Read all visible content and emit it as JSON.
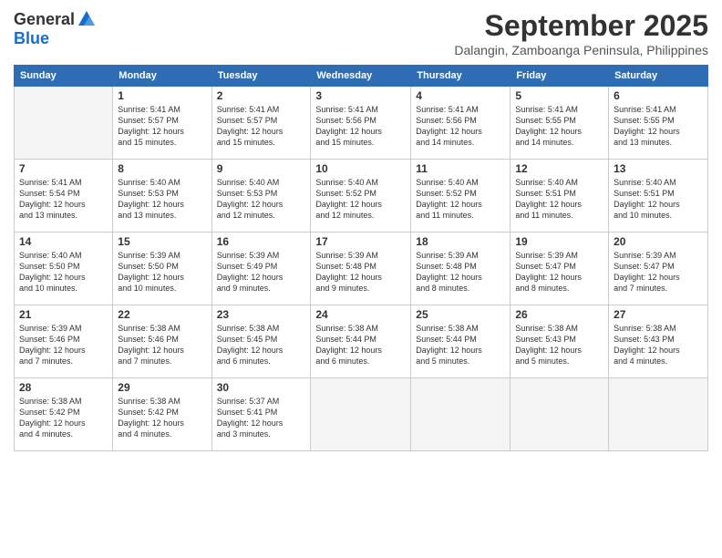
{
  "logo": {
    "general": "General",
    "blue": "Blue"
  },
  "title": "September 2025",
  "subtitle": "Dalangin, Zamboanga Peninsula, Philippines",
  "days": [
    "Sunday",
    "Monday",
    "Tuesday",
    "Wednesday",
    "Thursday",
    "Friday",
    "Saturday"
  ],
  "weeks": [
    [
      {
        "day": "",
        "info": ""
      },
      {
        "day": "1",
        "info": "Sunrise: 5:41 AM\nSunset: 5:57 PM\nDaylight: 12 hours\nand 15 minutes."
      },
      {
        "day": "2",
        "info": "Sunrise: 5:41 AM\nSunset: 5:57 PM\nDaylight: 12 hours\nand 15 minutes."
      },
      {
        "day": "3",
        "info": "Sunrise: 5:41 AM\nSunset: 5:56 PM\nDaylight: 12 hours\nand 15 minutes."
      },
      {
        "day": "4",
        "info": "Sunrise: 5:41 AM\nSunset: 5:56 PM\nDaylight: 12 hours\nand 14 minutes."
      },
      {
        "day": "5",
        "info": "Sunrise: 5:41 AM\nSunset: 5:55 PM\nDaylight: 12 hours\nand 14 minutes."
      },
      {
        "day": "6",
        "info": "Sunrise: 5:41 AM\nSunset: 5:55 PM\nDaylight: 12 hours\nand 13 minutes."
      }
    ],
    [
      {
        "day": "7",
        "info": "Sunrise: 5:41 AM\nSunset: 5:54 PM\nDaylight: 12 hours\nand 13 minutes."
      },
      {
        "day": "8",
        "info": "Sunrise: 5:40 AM\nSunset: 5:53 PM\nDaylight: 12 hours\nand 13 minutes."
      },
      {
        "day": "9",
        "info": "Sunrise: 5:40 AM\nSunset: 5:53 PM\nDaylight: 12 hours\nand 12 minutes."
      },
      {
        "day": "10",
        "info": "Sunrise: 5:40 AM\nSunset: 5:52 PM\nDaylight: 12 hours\nand 12 minutes."
      },
      {
        "day": "11",
        "info": "Sunrise: 5:40 AM\nSunset: 5:52 PM\nDaylight: 12 hours\nand 11 minutes."
      },
      {
        "day": "12",
        "info": "Sunrise: 5:40 AM\nSunset: 5:51 PM\nDaylight: 12 hours\nand 11 minutes."
      },
      {
        "day": "13",
        "info": "Sunrise: 5:40 AM\nSunset: 5:51 PM\nDaylight: 12 hours\nand 10 minutes."
      }
    ],
    [
      {
        "day": "14",
        "info": "Sunrise: 5:40 AM\nSunset: 5:50 PM\nDaylight: 12 hours\nand 10 minutes."
      },
      {
        "day": "15",
        "info": "Sunrise: 5:39 AM\nSunset: 5:50 PM\nDaylight: 12 hours\nand 10 minutes."
      },
      {
        "day": "16",
        "info": "Sunrise: 5:39 AM\nSunset: 5:49 PM\nDaylight: 12 hours\nand 9 minutes."
      },
      {
        "day": "17",
        "info": "Sunrise: 5:39 AM\nSunset: 5:48 PM\nDaylight: 12 hours\nand 9 minutes."
      },
      {
        "day": "18",
        "info": "Sunrise: 5:39 AM\nSunset: 5:48 PM\nDaylight: 12 hours\nand 8 minutes."
      },
      {
        "day": "19",
        "info": "Sunrise: 5:39 AM\nSunset: 5:47 PM\nDaylight: 12 hours\nand 8 minutes."
      },
      {
        "day": "20",
        "info": "Sunrise: 5:39 AM\nSunset: 5:47 PM\nDaylight: 12 hours\nand 7 minutes."
      }
    ],
    [
      {
        "day": "21",
        "info": "Sunrise: 5:39 AM\nSunset: 5:46 PM\nDaylight: 12 hours\nand 7 minutes."
      },
      {
        "day": "22",
        "info": "Sunrise: 5:38 AM\nSunset: 5:46 PM\nDaylight: 12 hours\nand 7 minutes."
      },
      {
        "day": "23",
        "info": "Sunrise: 5:38 AM\nSunset: 5:45 PM\nDaylight: 12 hours\nand 6 minutes."
      },
      {
        "day": "24",
        "info": "Sunrise: 5:38 AM\nSunset: 5:44 PM\nDaylight: 12 hours\nand 6 minutes."
      },
      {
        "day": "25",
        "info": "Sunrise: 5:38 AM\nSunset: 5:44 PM\nDaylight: 12 hours\nand 5 minutes."
      },
      {
        "day": "26",
        "info": "Sunrise: 5:38 AM\nSunset: 5:43 PM\nDaylight: 12 hours\nand 5 minutes."
      },
      {
        "day": "27",
        "info": "Sunrise: 5:38 AM\nSunset: 5:43 PM\nDaylight: 12 hours\nand 4 minutes."
      }
    ],
    [
      {
        "day": "28",
        "info": "Sunrise: 5:38 AM\nSunset: 5:42 PM\nDaylight: 12 hours\nand 4 minutes."
      },
      {
        "day": "29",
        "info": "Sunrise: 5:38 AM\nSunset: 5:42 PM\nDaylight: 12 hours\nand 4 minutes."
      },
      {
        "day": "30",
        "info": "Sunrise: 5:37 AM\nSunset: 5:41 PM\nDaylight: 12 hours\nand 3 minutes."
      },
      {
        "day": "",
        "info": ""
      },
      {
        "day": "",
        "info": ""
      },
      {
        "day": "",
        "info": ""
      },
      {
        "day": "",
        "info": ""
      }
    ]
  ]
}
